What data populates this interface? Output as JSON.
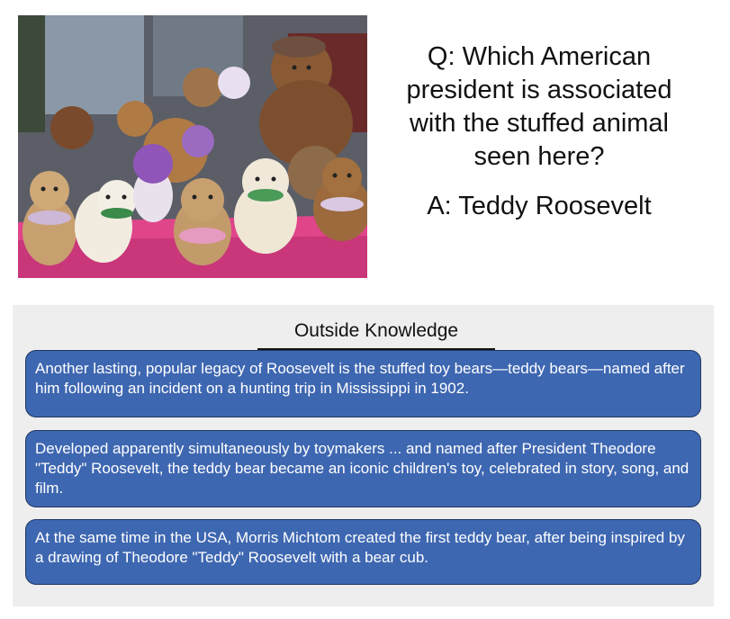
{
  "photo": {
    "subject": "teddy-bears-photo"
  },
  "qa": {
    "question": "Q: Which American president is associated with the stuffed animal seen here?",
    "answer": "A: Teddy Roosevelt"
  },
  "knowledge": {
    "title": "Outside Knowledge",
    "facts": [
      "Another lasting, popular legacy of Roosevelt is the stuffed toy bears—teddy bears—named after him following an incident on a hunting trip in Mississippi in 1902.",
      "Developed apparently simultaneously by toymakers ... and named after President Theodore \"Teddy\" Roosevelt, the teddy bear became an iconic children's toy, celebrated in story, song, and film.",
      "At the same time in the USA, Morris Michtom created the first teddy bear, after being inspired by a drawing of Theodore \"Teddy\" Roosevelt with a bear cub."
    ]
  },
  "colors": {
    "fact_box": "#3e67b1",
    "fact_border": "#1f3761",
    "panel_bg": "#eeeeee",
    "tablecloth": "#e0458a"
  }
}
